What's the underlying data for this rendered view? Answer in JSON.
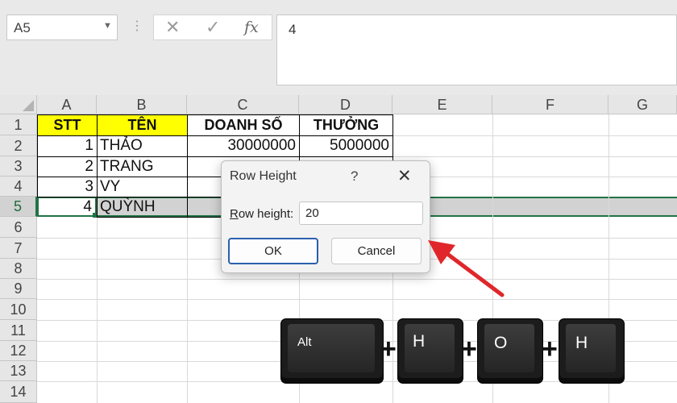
{
  "name_box": {
    "value": "A5"
  },
  "formula": {
    "cancel_glyph": "✕",
    "enter_glyph": "✓",
    "fx_label": "fx",
    "content": "4"
  },
  "columns": [
    "A",
    "B",
    "C",
    "D",
    "E",
    "F",
    "G"
  ],
  "rows": [
    "1",
    "2",
    "3",
    "4",
    "5",
    "6",
    "7",
    "8",
    "9",
    "10",
    "11",
    "12",
    "13",
    "14"
  ],
  "selected_row": "5",
  "table": {
    "headers": [
      "STT",
      "TÊN",
      "DOANH SỐ",
      "THƯỞNG"
    ],
    "records": [
      {
        "stt": "1",
        "ten": "THẢO",
        "doanh_so": "30000000",
        "thuong": "5000000"
      },
      {
        "stt": "2",
        "ten": "TRANG"
      },
      {
        "stt": "3",
        "ten": "VY"
      },
      {
        "stt": "4",
        "ten": "QUỲNH"
      }
    ]
  },
  "dialog": {
    "title": "Row Height",
    "help": "?",
    "close": "✕",
    "label_accesskey": "R",
    "label_rest": "ow height:",
    "value": "20",
    "ok": "OK",
    "cancel": "Cancel"
  },
  "shortcut": {
    "keys": [
      "Alt",
      "H",
      "O",
      "H"
    ],
    "separator": "+"
  },
  "colors": {
    "header_fill": "#ffff00",
    "selection": "#217346",
    "arrow": "#e0262a"
  }
}
